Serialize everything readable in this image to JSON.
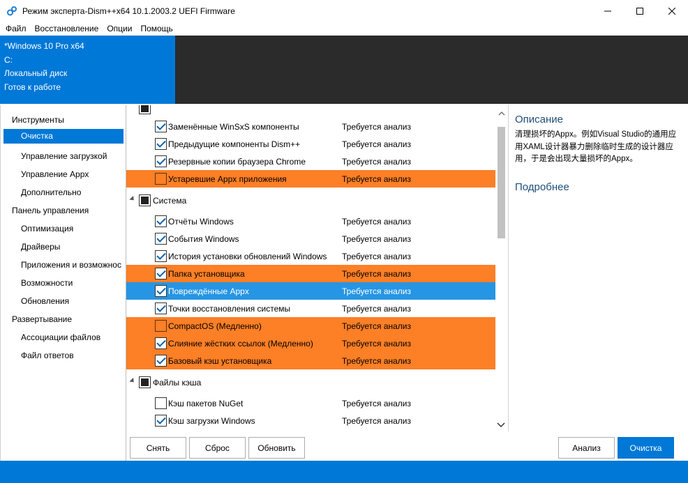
{
  "window": {
    "title": "Режим эксперта-Dism++x64 10.1.2003.2 UEFI Firmware",
    "minimize": "—",
    "maximize": "☐",
    "close": "✕"
  },
  "menu": [
    "Файл",
    "Восстановление",
    "Опции",
    "Помощь"
  ],
  "header": {
    "line1": "*Windows 10 Pro x64",
    "line2": "C:",
    "line3": "Локальный диск",
    "line4": "Готов к работе"
  },
  "sidebar": {
    "groups": [
      {
        "label": "Инструменты",
        "items": [
          "Очистка",
          "Управление загрузкой",
          "Управление Appx",
          "Дополнительно"
        ]
      },
      {
        "label": "Панель управления",
        "items": [
          "Оптимизация",
          "Драйверы",
          "Приложения и возможнос",
          "Возможности",
          "Обновления"
        ]
      },
      {
        "label": "Развертывание",
        "items": [
          "Ассоциации файлов",
          "Файл ответов"
        ]
      }
    ],
    "active": "Очистка"
  },
  "list": {
    "status_text": "Требуется анализ",
    "rows": [
      {
        "label": "Заменённые WinSxS компоненты",
        "checked": true,
        "style": "normal"
      },
      {
        "label": "Предыдущие компоненты Dism++",
        "checked": true,
        "style": "normal"
      },
      {
        "label": "Резервные копии браузера Chrome",
        "checked": true,
        "style": "normal"
      },
      {
        "label": "Устаревшие Appx приложения",
        "checked": false,
        "style": "orange"
      },
      {
        "group": "Система"
      },
      {
        "label": "Отчёты Windows",
        "checked": true,
        "style": "normal"
      },
      {
        "label": "События Windows",
        "checked": true,
        "style": "normal"
      },
      {
        "label": "История установки обновлений Windows",
        "checked": true,
        "style": "normal"
      },
      {
        "label": "Папка установщика",
        "checked": true,
        "style": "orange"
      },
      {
        "label": "Повреждённые Appx",
        "checked": true,
        "style": "selected"
      },
      {
        "label": "Точки восстановления системы",
        "checked": true,
        "style": "normal"
      },
      {
        "label": "CompactOS (Медленно)",
        "checked": false,
        "style": "orange"
      },
      {
        "label": "Слияние жёстких ссылок (Медленно)",
        "checked": true,
        "style": "orange"
      },
      {
        "label": "Базовый кэш установщика",
        "checked": true,
        "style": "orange"
      },
      {
        "group": "Файлы кэша"
      },
      {
        "label": "Кэш пакетов NuGet",
        "checked": false,
        "style": "normal"
      },
      {
        "label": "Кэш загрузки Windows",
        "checked": true,
        "style": "normal"
      }
    ]
  },
  "description": {
    "title": "Описание",
    "text": "清理损坏的Appx。例如Visual Studio的通用应用XAML设计器暴力删除临时生成的设计器应用，于是会出现大量损坏的Appx。",
    "more": "Подробнее"
  },
  "buttons": {
    "remove": "Снять",
    "reset": "Сброс",
    "refresh": "Обновить",
    "analyze": "Анализ",
    "clean": "Очистка"
  },
  "colors": {
    "accent": "#0078d7",
    "warning_row": "#fd7f26",
    "selected_row": "#2695e4"
  }
}
